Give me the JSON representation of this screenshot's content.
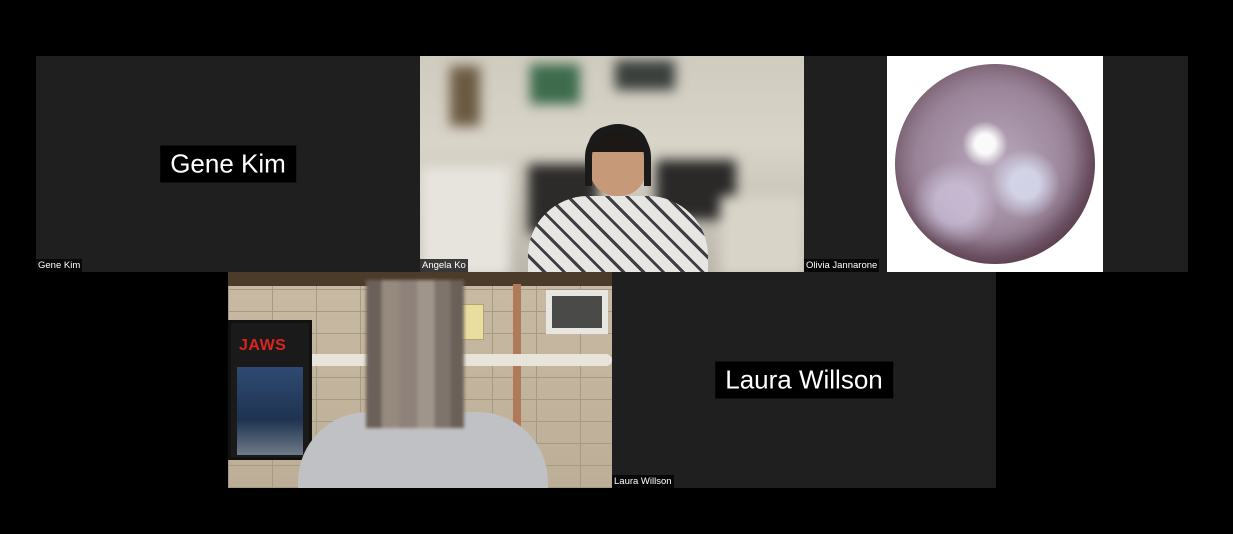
{
  "participants": [
    {
      "name": "Gene Kim",
      "card_name": "Gene Kim",
      "video": "off"
    },
    {
      "name": "Angela Ko",
      "video": "on"
    },
    {
      "name": "Olivia Jannarone",
      "video": "image"
    },
    {
      "name": "",
      "video": "on",
      "poster_text": "JAWS"
    },
    {
      "name": "Laura Willson",
      "card_name": "Laura Willson",
      "video": "off"
    }
  ],
  "colors": {
    "background": "#000000",
    "tile": "#1f1f1f",
    "name_text": "#ffffff"
  }
}
